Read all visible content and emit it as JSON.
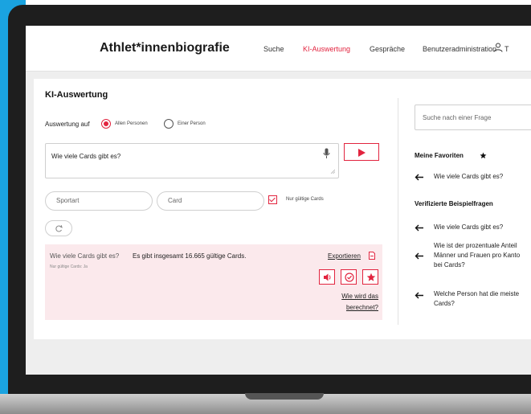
{
  "app": {
    "title": "Athlet*innenbiografie"
  },
  "nav": {
    "items": [
      {
        "label": "Suche"
      },
      {
        "label": "KI-Auswertung",
        "active": true
      },
      {
        "label": "Gespräche"
      },
      {
        "label": "Benutzeradministration"
      }
    ],
    "user_label": "T"
  },
  "main": {
    "title": "KI-Auswertung",
    "mode": {
      "label": "Auswertung auf",
      "options": [
        {
          "label": "Allen Personen",
          "selected": true
        },
        {
          "label": "Einer Person",
          "selected": false
        }
      ]
    },
    "question": {
      "value": "Wie viele Cards gibt es?"
    },
    "filters": {
      "sportart_placeholder": "Sportart",
      "card_placeholder": "Card",
      "valid_only_label": "Nur gültige Cards",
      "valid_only_checked": true
    },
    "result": {
      "question": "Wie viele Cards gibt es?",
      "filter_note": "Nur gültige Cards: Ja",
      "answer": "Es gibt insgesamt 16.665 gültige Cards.",
      "export_label": "Exportieren",
      "calc_label": "Wie wird das berechnet?"
    }
  },
  "sidebar": {
    "search_placeholder": "Suche nach einer Frage",
    "favorites_title": "Meine Favoriten",
    "favorites": [
      {
        "label": "Wie viele Cards gibt es?"
      }
    ],
    "examples_title": "Verifizierte Beispielfragen",
    "examples": [
      {
        "label": "Wie viele Cards gibt es?"
      },
      {
        "label": "Wie ist der prozentuale Anteil Männer und Frauen pro Kanto bei Cards?"
      },
      {
        "label": "Welche Person hat die meiste Cards?"
      }
    ]
  },
  "colors": {
    "accent": "#e2243f",
    "frame": "#1e1e1e",
    "background_band": "#1aa3e0"
  },
  "icons": [
    "user-icon",
    "microphone-icon",
    "play-icon",
    "checkbox-check-icon",
    "reset-icon",
    "export-file-icon",
    "speaker-icon",
    "verify-check-icon",
    "star-icon",
    "arrow-left-icon"
  ]
}
